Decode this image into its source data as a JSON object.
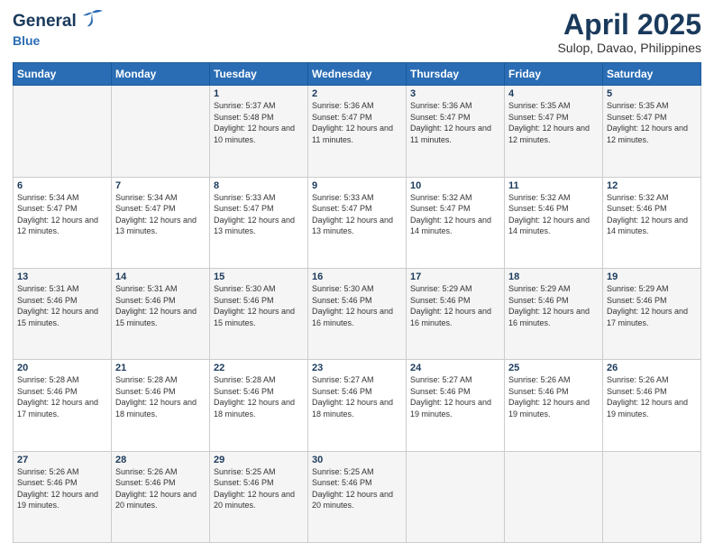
{
  "header": {
    "logo_general": "General",
    "logo_blue": "Blue",
    "title": "April 2025",
    "subtitle": "Sulop, Davao, Philippines"
  },
  "calendar": {
    "days_of_week": [
      "Sunday",
      "Monday",
      "Tuesday",
      "Wednesday",
      "Thursday",
      "Friday",
      "Saturday"
    ],
    "weeks": [
      [
        {
          "num": "",
          "sunrise": "",
          "sunset": "",
          "daylight": ""
        },
        {
          "num": "",
          "sunrise": "",
          "sunset": "",
          "daylight": ""
        },
        {
          "num": "1",
          "sunrise": "Sunrise: 5:37 AM",
          "sunset": "Sunset: 5:48 PM",
          "daylight": "Daylight: 12 hours and 10 minutes."
        },
        {
          "num": "2",
          "sunrise": "Sunrise: 5:36 AM",
          "sunset": "Sunset: 5:47 PM",
          "daylight": "Daylight: 12 hours and 11 minutes."
        },
        {
          "num": "3",
          "sunrise": "Sunrise: 5:36 AM",
          "sunset": "Sunset: 5:47 PM",
          "daylight": "Daylight: 12 hours and 11 minutes."
        },
        {
          "num": "4",
          "sunrise": "Sunrise: 5:35 AM",
          "sunset": "Sunset: 5:47 PM",
          "daylight": "Daylight: 12 hours and 12 minutes."
        },
        {
          "num": "5",
          "sunrise": "Sunrise: 5:35 AM",
          "sunset": "Sunset: 5:47 PM",
          "daylight": "Daylight: 12 hours and 12 minutes."
        }
      ],
      [
        {
          "num": "6",
          "sunrise": "Sunrise: 5:34 AM",
          "sunset": "Sunset: 5:47 PM",
          "daylight": "Daylight: 12 hours and 12 minutes."
        },
        {
          "num": "7",
          "sunrise": "Sunrise: 5:34 AM",
          "sunset": "Sunset: 5:47 PM",
          "daylight": "Daylight: 12 hours and 13 minutes."
        },
        {
          "num": "8",
          "sunrise": "Sunrise: 5:33 AM",
          "sunset": "Sunset: 5:47 PM",
          "daylight": "Daylight: 12 hours and 13 minutes."
        },
        {
          "num": "9",
          "sunrise": "Sunrise: 5:33 AM",
          "sunset": "Sunset: 5:47 PM",
          "daylight": "Daylight: 12 hours and 13 minutes."
        },
        {
          "num": "10",
          "sunrise": "Sunrise: 5:32 AM",
          "sunset": "Sunset: 5:47 PM",
          "daylight": "Daylight: 12 hours and 14 minutes."
        },
        {
          "num": "11",
          "sunrise": "Sunrise: 5:32 AM",
          "sunset": "Sunset: 5:46 PM",
          "daylight": "Daylight: 12 hours and 14 minutes."
        },
        {
          "num": "12",
          "sunrise": "Sunrise: 5:32 AM",
          "sunset": "Sunset: 5:46 PM",
          "daylight": "Daylight: 12 hours and 14 minutes."
        }
      ],
      [
        {
          "num": "13",
          "sunrise": "Sunrise: 5:31 AM",
          "sunset": "Sunset: 5:46 PM",
          "daylight": "Daylight: 12 hours and 15 minutes."
        },
        {
          "num": "14",
          "sunrise": "Sunrise: 5:31 AM",
          "sunset": "Sunset: 5:46 PM",
          "daylight": "Daylight: 12 hours and 15 minutes."
        },
        {
          "num": "15",
          "sunrise": "Sunrise: 5:30 AM",
          "sunset": "Sunset: 5:46 PM",
          "daylight": "Daylight: 12 hours and 15 minutes."
        },
        {
          "num": "16",
          "sunrise": "Sunrise: 5:30 AM",
          "sunset": "Sunset: 5:46 PM",
          "daylight": "Daylight: 12 hours and 16 minutes."
        },
        {
          "num": "17",
          "sunrise": "Sunrise: 5:29 AM",
          "sunset": "Sunset: 5:46 PM",
          "daylight": "Daylight: 12 hours and 16 minutes."
        },
        {
          "num": "18",
          "sunrise": "Sunrise: 5:29 AM",
          "sunset": "Sunset: 5:46 PM",
          "daylight": "Daylight: 12 hours and 16 minutes."
        },
        {
          "num": "19",
          "sunrise": "Sunrise: 5:29 AM",
          "sunset": "Sunset: 5:46 PM",
          "daylight": "Daylight: 12 hours and 17 minutes."
        }
      ],
      [
        {
          "num": "20",
          "sunrise": "Sunrise: 5:28 AM",
          "sunset": "Sunset: 5:46 PM",
          "daylight": "Daylight: 12 hours and 17 minutes."
        },
        {
          "num": "21",
          "sunrise": "Sunrise: 5:28 AM",
          "sunset": "Sunset: 5:46 PM",
          "daylight": "Daylight: 12 hours and 18 minutes."
        },
        {
          "num": "22",
          "sunrise": "Sunrise: 5:28 AM",
          "sunset": "Sunset: 5:46 PM",
          "daylight": "Daylight: 12 hours and 18 minutes."
        },
        {
          "num": "23",
          "sunrise": "Sunrise: 5:27 AM",
          "sunset": "Sunset: 5:46 PM",
          "daylight": "Daylight: 12 hours and 18 minutes."
        },
        {
          "num": "24",
          "sunrise": "Sunrise: 5:27 AM",
          "sunset": "Sunset: 5:46 PM",
          "daylight": "Daylight: 12 hours and 19 minutes."
        },
        {
          "num": "25",
          "sunrise": "Sunrise: 5:26 AM",
          "sunset": "Sunset: 5:46 PM",
          "daylight": "Daylight: 12 hours and 19 minutes."
        },
        {
          "num": "26",
          "sunrise": "Sunrise: 5:26 AM",
          "sunset": "Sunset: 5:46 PM",
          "daylight": "Daylight: 12 hours and 19 minutes."
        }
      ],
      [
        {
          "num": "27",
          "sunrise": "Sunrise: 5:26 AM",
          "sunset": "Sunset: 5:46 PM",
          "daylight": "Daylight: 12 hours and 19 minutes."
        },
        {
          "num": "28",
          "sunrise": "Sunrise: 5:26 AM",
          "sunset": "Sunset: 5:46 PM",
          "daylight": "Daylight: 12 hours and 20 minutes."
        },
        {
          "num": "29",
          "sunrise": "Sunrise: 5:25 AM",
          "sunset": "Sunset: 5:46 PM",
          "daylight": "Daylight: 12 hours and 20 minutes."
        },
        {
          "num": "30",
          "sunrise": "Sunrise: 5:25 AM",
          "sunset": "Sunset: 5:46 PM",
          "daylight": "Daylight: 12 hours and 20 minutes."
        },
        {
          "num": "",
          "sunrise": "",
          "sunset": "",
          "daylight": ""
        },
        {
          "num": "",
          "sunrise": "",
          "sunset": "",
          "daylight": ""
        },
        {
          "num": "",
          "sunrise": "",
          "sunset": "",
          "daylight": ""
        }
      ]
    ]
  }
}
